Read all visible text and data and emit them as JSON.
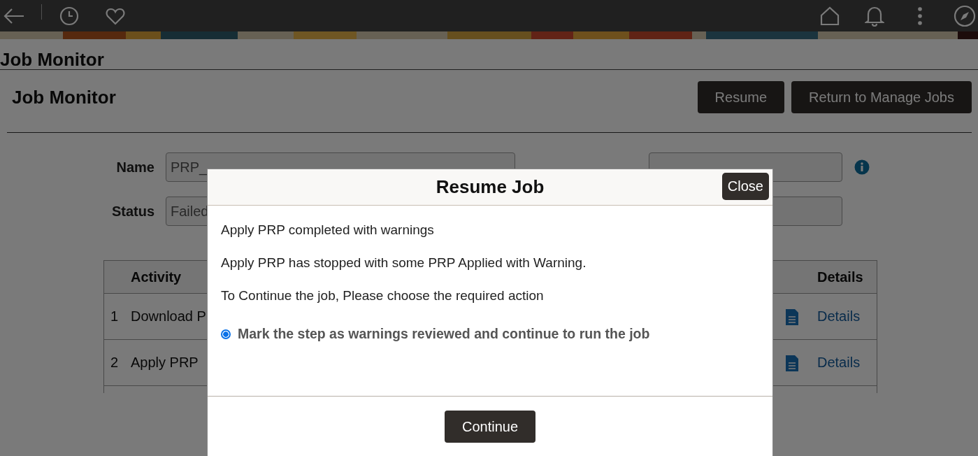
{
  "page_title": "Job Monitor",
  "section": {
    "title": "Job Monitor",
    "buttons": [
      "Resume",
      "Return to Manage Jobs"
    ]
  },
  "form": {
    "fields": [
      {
        "label": "Name",
        "value": "PRP_"
      },
      {
        "label": "Status",
        "value": "Failed"
      }
    ]
  },
  "table": {
    "columns": [
      "Activity",
      "Details"
    ],
    "rows": [
      {
        "number": "1",
        "activity": "Download P",
        "details": "Details"
      },
      {
        "number": "2",
        "activity": "Apply PRP",
        "details": "Details"
      }
    ]
  },
  "dialog": {
    "title": "Resume Job",
    "close": "Close",
    "messages": [
      "Apply PRP completed with warnings",
      "Apply PRP has stopped with some PRP Applied with Warning.",
      "To Continue the job, Please choose the required action"
    ],
    "options": [
      {
        "label": "Mark the step as warnings reviewed and continue to run the job",
        "selected": true
      }
    ],
    "continue": "Continue"
  }
}
